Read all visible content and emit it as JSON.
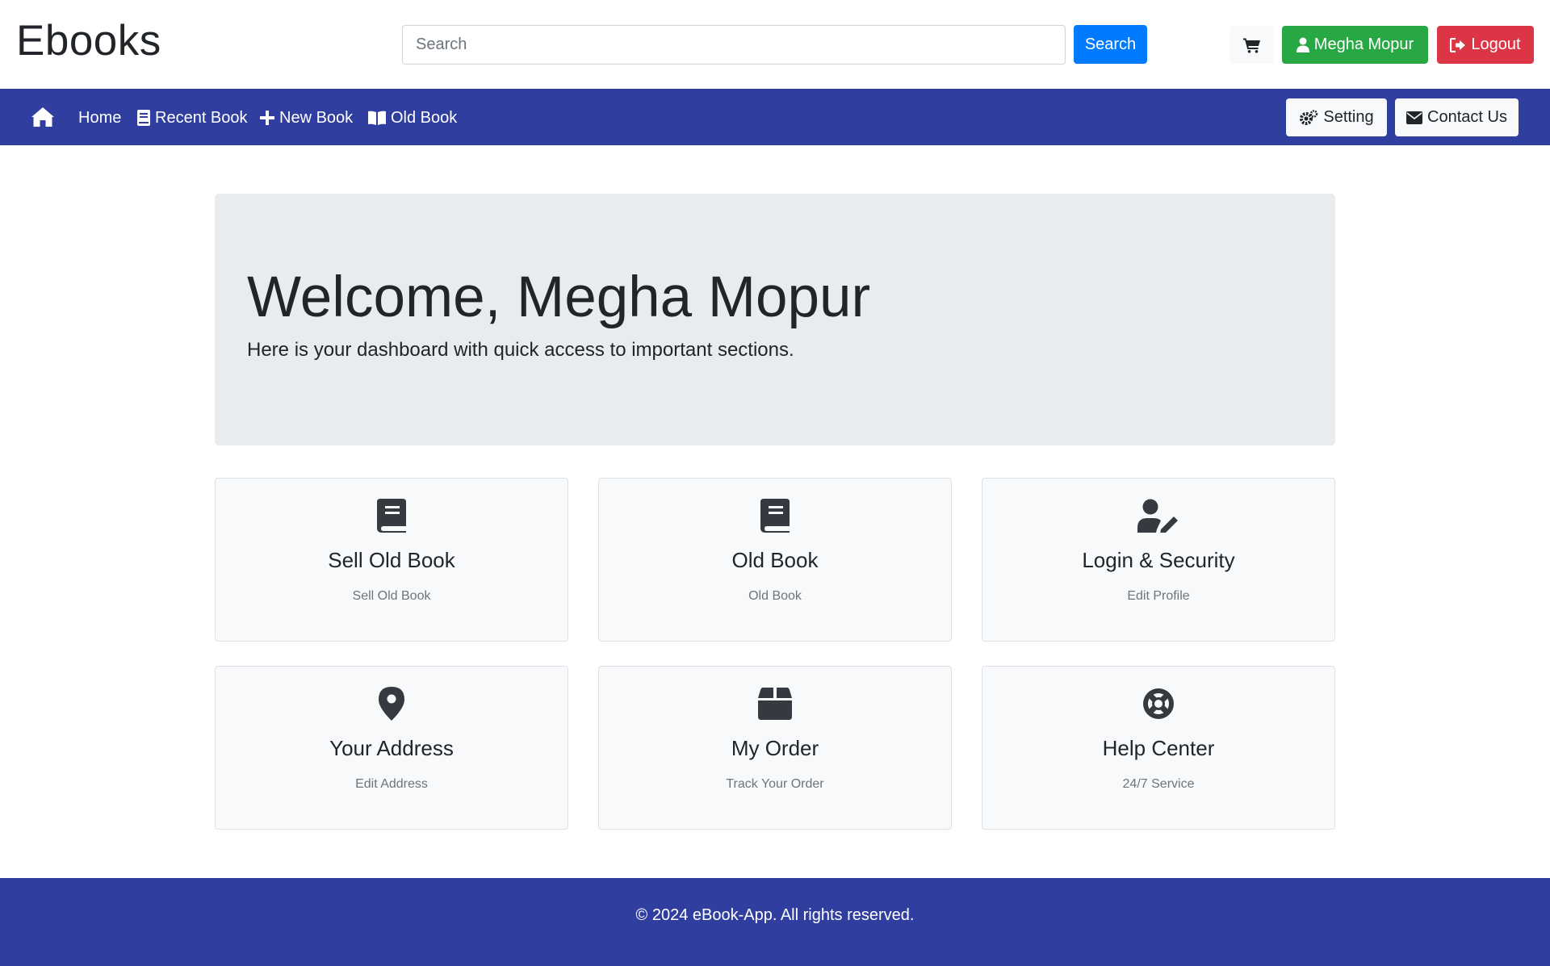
{
  "header": {
    "brand": "Ebooks",
    "search_placeholder": "Search",
    "search_value": "",
    "search_button": "Search",
    "cart_icon": "shopping-cart-icon",
    "user_name": "Megha Mopur",
    "logout_label": "Logout"
  },
  "nav": {
    "home_icon": "home-icon",
    "links": [
      {
        "label": "Home"
      },
      {
        "label": "Recent Book",
        "icon": "book-icon"
      },
      {
        "label": "New Book",
        "icon": "plus-icon"
      },
      {
        "label": "Old Book",
        "icon": "open-book-icon"
      }
    ],
    "setting_label": "Setting",
    "contact_label": "Contact Us"
  },
  "hero": {
    "title": "Welcome, Megha Mopur",
    "subtitle": "Here is your dashboard with quick access to important sections."
  },
  "cards": [
    {
      "title": "Sell Old Book",
      "subtitle": "Sell Old Book",
      "icon": "book-icon"
    },
    {
      "title": "Old Book",
      "subtitle": "Old Book",
      "icon": "book-icon"
    },
    {
      "title": "Login & Security",
      "subtitle": "Edit Profile",
      "icon": "user-edit-icon"
    },
    {
      "title": "Your Address",
      "subtitle": "Edit Address",
      "icon": "map-marker-icon"
    },
    {
      "title": "My Order",
      "subtitle": "Track Your Order",
      "icon": "box-icon"
    },
    {
      "title": "Help Center",
      "subtitle": "24/7 Service",
      "icon": "life-ring-icon"
    }
  ],
  "footer": {
    "text": "© 2024 eBook-App. All rights reserved."
  },
  "colors": {
    "nav_bg": "#303f9f",
    "primary": "#007bff",
    "success": "#28a745",
    "danger": "#dc3545",
    "hero_bg": "#e9ecef",
    "card_bg": "#f8f9fa"
  }
}
